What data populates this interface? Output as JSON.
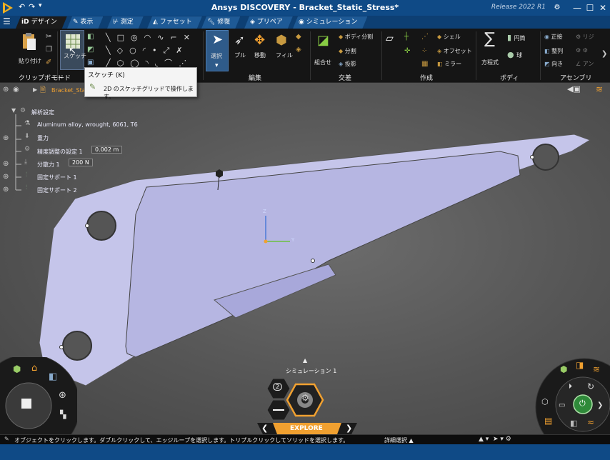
{
  "titlebar": {
    "title": "Ansys DISCOVERY - Bracket_Static_Stress*",
    "release": "Release 2022 R1"
  },
  "tabs": [
    {
      "label": "デザイン",
      "active": true
    },
    {
      "label": "表示"
    },
    {
      "label": "測定"
    },
    {
      "label": "ファセット"
    },
    {
      "label": "修復"
    },
    {
      "label": "プリペア"
    },
    {
      "label": "シミュレーション"
    }
  ],
  "ribbon": {
    "clipboard": {
      "label": "クリップボード",
      "paste": "貼り付け"
    },
    "mode": {
      "label": "モード",
      "sketch": "スケッチ"
    },
    "edit": {
      "label": "編集",
      "select": "選択",
      "pull": "プル",
      "move": "移動",
      "fill": "フィル"
    },
    "intersect": {
      "label": "交差",
      "combine": "組合せ",
      "split_body": "ボディ分割",
      "split": "分割",
      "project": "投影"
    },
    "create": {
      "label": "作成",
      "shell": "シェル",
      "offset": "オフセット",
      "mirror": "ミラー"
    },
    "body": {
      "label": "ボディ",
      "equation": "方程式",
      "cylinder": "円筒",
      "sphere": "球"
    },
    "assembly": {
      "label": "アセンブリ",
      "align": "正接",
      "arrange": "整列",
      "orient": "向き",
      "rigid": "リジ",
      "angle": "アン"
    }
  },
  "tooltip": {
    "title": "スケッチ (K)",
    "desc": "2D のスケッチグリッドで操作します。"
  },
  "tree": {
    "root": "Bracket_Sta",
    "items": [
      {
        "label": "解析設定"
      },
      {
        "label": "Aluminum alloy, wrought, 6061, T6"
      },
      {
        "label": "重力"
      },
      {
        "label": "精度調整の設定 1",
        "value": "0.002 m"
      },
      {
        "label": "分散力 1",
        "value": "200 N"
      },
      {
        "label": "固定サポート 1"
      },
      {
        "label": "固定サポート 2"
      }
    ]
  },
  "viewport": {
    "simulation_label": "シミュレーション 1",
    "badge_count": "2",
    "explore_label": "EXPLORE",
    "axis_z": "Z",
    "axis_y": "Y"
  },
  "statusbar": {
    "message": "オブジェクトをクリックします。ダブルクリックして、エッジループを選択します。トリプルクリックしてソリッドを選択します。",
    "detail_select": "詳細選択"
  },
  "colors": {
    "title_bg": "#0f4a86",
    "ribbon_bg": "#151515",
    "part": "#c5c5ea",
    "accent": "#f0a030"
  }
}
